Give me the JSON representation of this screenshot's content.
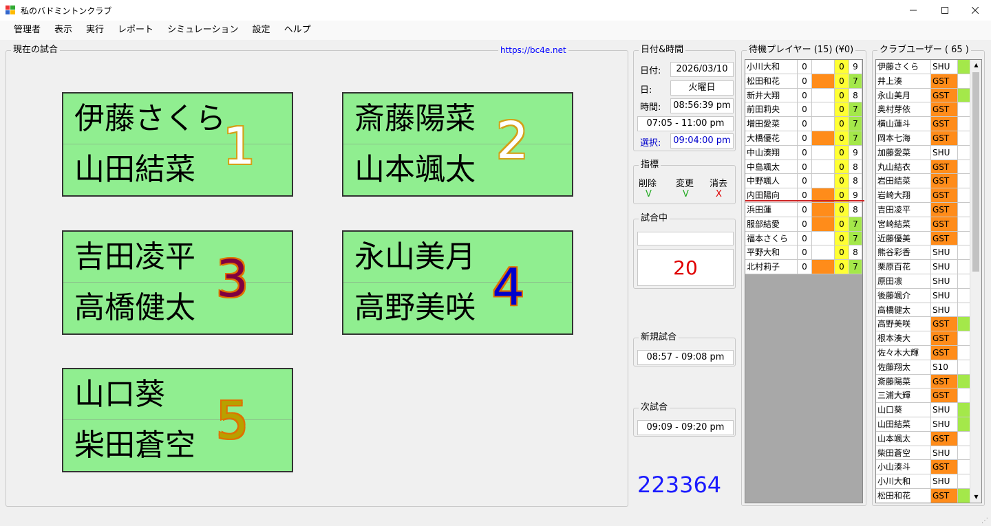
{
  "window": {
    "title": "私のバドミントンクラブ",
    "min_icon": "minimize-icon",
    "max_icon": "maximize-icon",
    "close_icon": "close-icon"
  },
  "menu": [
    "管理者",
    "表示",
    "実行",
    "レポート",
    "シミュレーション",
    "設定",
    "ヘルプ"
  ],
  "current": {
    "title": "現在の試合",
    "url": "https://bc4e.net",
    "courts": [
      {
        "num": "1",
        "p1": "伊藤さくら",
        "p2": "山田結菜",
        "color": "#ffffff",
        "outline": "#d4a017"
      },
      {
        "num": "2",
        "p1": "斎藤陽菜",
        "p2": "山本颯太",
        "color": "#ffffff",
        "outline": "#d4a017"
      },
      {
        "num": "3",
        "p1": "吉田凌平",
        "p2": "高橋健太",
        "color": "#800040",
        "outline": "#e07000"
      },
      {
        "num": "4",
        "p1": "永山美月",
        "p2": "高野美咲",
        "color": "#0000cc",
        "outline": "#e07000"
      },
      {
        "num": "5",
        "p1": "山口葵",
        "p2": "柴田蒼空",
        "color": "#b8a000",
        "outline": "#e07000"
      }
    ]
  },
  "datetime": {
    "title": "日付&時間",
    "date_label": "日付:",
    "date": "2026/03/10",
    "day_label": "日:",
    "day": "火曜日",
    "time_label": "時間:",
    "time": "08:56:39 pm",
    "range": "07:05 - 11:00 pm",
    "select_label": "選択:",
    "select": "09:04:00 pm"
  },
  "indicator": {
    "title": "指標",
    "labels": [
      "削除",
      "変更",
      "消去"
    ],
    "marks": [
      "V",
      "V",
      "X"
    ],
    "colors": [
      "#22aa22",
      "#22aa22",
      "#dd0000"
    ]
  },
  "playing": {
    "title": "試合中",
    "input": "",
    "count": "20"
  },
  "new_match": {
    "title": "新規試合",
    "time": "08:57 - 09:08 pm"
  },
  "next_match": {
    "title": "次試合",
    "time": "09:09 - 09:20 pm"
  },
  "footer_number": "223364",
  "waiting": {
    "title": "待機プレイヤー (15) (¥0)",
    "rows": [
      {
        "name": "小川大和",
        "a": "0",
        "b": "",
        "c": "0",
        "d": "9",
        "bc": "white",
        "dc": "white"
      },
      {
        "name": "松田和花",
        "a": "0",
        "b": "",
        "c": "0",
        "d": "7",
        "bc": "orange",
        "dc": "green"
      },
      {
        "name": "新井大翔",
        "a": "0",
        "b": "",
        "c": "0",
        "d": "8",
        "bc": "white",
        "dc": "white"
      },
      {
        "name": "前田莉央",
        "a": "0",
        "b": "",
        "c": "0",
        "d": "7",
        "bc": "white",
        "dc": "green"
      },
      {
        "name": "増田愛菜",
        "a": "0",
        "b": "",
        "c": "0",
        "d": "7",
        "bc": "white",
        "dc": "green"
      },
      {
        "name": "大橋優花",
        "a": "0",
        "b": "",
        "c": "0",
        "d": "7",
        "bc": "orange",
        "dc": "green"
      },
      {
        "name": "中山湊翔",
        "a": "0",
        "b": "",
        "c": "0",
        "d": "9",
        "bc": "white",
        "dc": "white"
      },
      {
        "name": "中島颯太",
        "a": "0",
        "b": "",
        "c": "0",
        "d": "8",
        "bc": "white",
        "dc": "white"
      },
      {
        "name": "中野颯人",
        "a": "0",
        "b": "",
        "c": "0",
        "d": "8",
        "bc": "white",
        "dc": "white"
      },
      {
        "name": "内田陽向",
        "a": "0",
        "b": "",
        "c": "0",
        "d": "9",
        "bc": "orange",
        "dc": "white"
      },
      {
        "name": "浜田蓮",
        "a": "0",
        "b": "",
        "c": "0",
        "d": "8",
        "bc": "orange",
        "dc": "white"
      },
      {
        "name": "服部結愛",
        "a": "0",
        "b": "",
        "c": "0",
        "d": "7",
        "bc": "orange",
        "dc": "green"
      },
      {
        "name": "福本さくら",
        "a": "0",
        "b": "",
        "c": "0",
        "d": "7",
        "bc": "white",
        "dc": "green"
      },
      {
        "name": "平野大和",
        "a": "0",
        "b": "",
        "c": "0",
        "d": "8",
        "bc": "white",
        "dc": "white"
      },
      {
        "name": "北村莉子",
        "a": "0",
        "b": "",
        "c": "0",
        "d": "7",
        "bc": "orange",
        "dc": "green"
      }
    ]
  },
  "club": {
    "title": "クラブユーザー ( 65 )",
    "rows": [
      {
        "name": "伊藤さくら",
        "type": "SHU",
        "flag": "green"
      },
      {
        "name": "井上湊",
        "type": "GST",
        "flag": "white"
      },
      {
        "name": "永山美月",
        "type": "GST",
        "flag": "green"
      },
      {
        "name": "奥村芽依",
        "type": "GST",
        "flag": "white"
      },
      {
        "name": "横山蓮斗",
        "type": "GST",
        "flag": "white"
      },
      {
        "name": "岡本七海",
        "type": "GST",
        "flag": "white"
      },
      {
        "name": "加藤愛菜",
        "type": "SHU",
        "flag": "white"
      },
      {
        "name": "丸山結衣",
        "type": "GST",
        "flag": "white"
      },
      {
        "name": "岩田結菜",
        "type": "GST",
        "flag": "white"
      },
      {
        "name": "岩崎大翔",
        "type": "GST",
        "flag": "white"
      },
      {
        "name": "吉田凌平",
        "type": "GST",
        "flag": "white"
      },
      {
        "name": "宮崎結菜",
        "type": "GST",
        "flag": "white"
      },
      {
        "name": "近藤優美",
        "type": "GST",
        "flag": "white"
      },
      {
        "name": "熊谷彩香",
        "type": "SHU",
        "flag": "white"
      },
      {
        "name": "栗原百花",
        "type": "SHU",
        "flag": "white"
      },
      {
        "name": "原田凛",
        "type": "SHU",
        "flag": "white"
      },
      {
        "name": "後藤颯介",
        "type": "SHU",
        "flag": "white"
      },
      {
        "name": "高橋健太",
        "type": "SHU",
        "flag": "white"
      },
      {
        "name": "高野美咲",
        "type": "GST",
        "flag": "green"
      },
      {
        "name": "根本湊大",
        "type": "GST",
        "flag": "white"
      },
      {
        "name": "佐々木大輝",
        "type": "GST",
        "flag": "white"
      },
      {
        "name": "佐藤翔太",
        "type": "S10",
        "flag": "white"
      },
      {
        "name": "斎藤陽菜",
        "type": "GST",
        "flag": "green"
      },
      {
        "name": "三浦大輝",
        "type": "GST",
        "flag": "white"
      },
      {
        "name": "山口葵",
        "type": "SHU",
        "flag": "green"
      },
      {
        "name": "山田結菜",
        "type": "SHU",
        "flag": "green"
      },
      {
        "name": "山本颯太",
        "type": "GST",
        "flag": "white"
      },
      {
        "name": "柴田蒼空",
        "type": "SHU",
        "flag": "white"
      },
      {
        "name": "小山湊斗",
        "type": "GST",
        "flag": "white"
      },
      {
        "name": "小川大和",
        "type": "SHU",
        "flag": "white"
      },
      {
        "name": "松田和花",
        "type": "GST",
        "flag": "green"
      }
    ]
  },
  "colors": {
    "orange": "#ff8c1a",
    "green": "#a4e84a",
    "yellow": "#ffff33",
    "white": "#ffffff",
    "court": "#90ee90"
  }
}
